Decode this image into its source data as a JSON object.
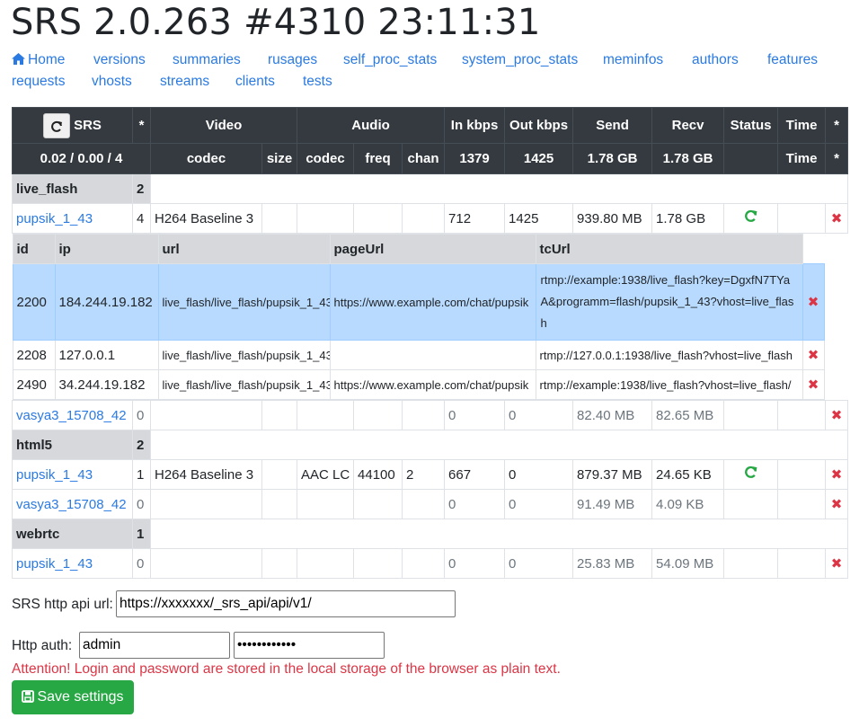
{
  "title": "SRS 2.0.263 #4310 23:11:31",
  "nav": [
    {
      "label": "Home",
      "icon": "home-icon"
    },
    {
      "label": "versions"
    },
    {
      "label": "summaries"
    },
    {
      "label": "rusages"
    },
    {
      "label": "self_proc_stats"
    },
    {
      "label": "system_proc_stats"
    },
    {
      "label": "meminfos"
    },
    {
      "label": "authors"
    },
    {
      "label": "features"
    },
    {
      "label": "requests"
    },
    {
      "label": "vhosts"
    },
    {
      "label": "streams"
    },
    {
      "label": "clients"
    },
    {
      "label": "tests"
    }
  ],
  "table": {
    "header1": {
      "srs": "SRS",
      "star": "*",
      "video": "Video",
      "audio": "Audio",
      "in_kbps": "In kbps",
      "out_kbps": "Out kbps",
      "send": "Send",
      "recv": "Recv",
      "status": "Status",
      "time": "Time",
      "star2": "*"
    },
    "header2": {
      "load": "0.02 / 0.00 / 4",
      "vcodec": "codec",
      "size": "size",
      "acodec": "codec",
      "freq": "freq",
      "chan": "chan",
      "in_kbps": "1379",
      "out_kbps": "1425",
      "send": "1.78 GB",
      "recv": "1.78 GB",
      "time": "Time",
      "star": "*"
    },
    "groups": [
      {
        "name": "live_flash",
        "count": "2",
        "streams": [
          {
            "name": "pupsik_1_43",
            "clients": "4",
            "vcodec": "H264 Baseline 3",
            "size": "",
            "acodec": "",
            "freq": "",
            "chan": "",
            "in_kbps": "712",
            "out_kbps": "1425",
            "send": "939.80 MB",
            "recv": "1.78 GB",
            "status_icon": "refresh-icon",
            "time": "",
            "client_table": {
              "headers": {
                "id": "id",
                "ip": "ip",
                "url": "url",
                "pageUrl": "pageUrl",
                "tcUrl": "tcUrl"
              },
              "rows": [
                {
                  "id": "2200",
                  "ip": "184.244.19.182",
                  "url": "live_flash/live_flash/pupsik_1_43",
                  "pageUrl": "https://www.example.com/chat/pupsik",
                  "tcUrl": "rtmp://example:1938/live_flash?key=DgxfN7TYaA&programm=flash/pupsik_1_43?vhost=live_flash",
                  "selected": true
                },
                {
                  "id": "2208",
                  "ip": "127.0.0.1",
                  "url": "live_flash/live_flash/pupsik_1_43",
                  "pageUrl": "",
                  "tcUrl": "rtmp://127.0.0.1:1938/live_flash?vhost=live_flash"
                },
                {
                  "id": "2490",
                  "ip": "34.244.19.182",
                  "url": "live_flash/live_flash/pupsik_1_43",
                  "pageUrl": "https://www.example.com/chat/pupsik",
                  "tcUrl": "rtmp://example:1938/live_flash?vhost=live_flash/"
                }
              ]
            }
          },
          {
            "name": "vasya3_15708_42",
            "clients": "0",
            "vcodec": "",
            "size": "",
            "acodec": "",
            "freq": "",
            "chan": "",
            "in_kbps": "0",
            "out_kbps": "0",
            "send": "82.40 MB",
            "recv": "82.65 MB",
            "time": ""
          }
        ]
      },
      {
        "name": "html5",
        "count": "2",
        "streams": [
          {
            "name": "pupsik_1_43",
            "clients": "1",
            "vcodec": "H264 Baseline 3",
            "size": "",
            "acodec": "AAC LC",
            "freq": "44100",
            "chan": "2",
            "in_kbps": "667",
            "out_kbps": "0",
            "send": "879.37 MB",
            "recv": "24.65 KB",
            "status_icon": "refresh-icon",
            "time": ""
          },
          {
            "name": "vasya3_15708_42",
            "clients": "0",
            "vcodec": "",
            "size": "",
            "acodec": "",
            "freq": "",
            "chan": "",
            "in_kbps": "0",
            "out_kbps": "0",
            "send": "91.49 MB",
            "recv": "4.09 KB",
            "time": ""
          }
        ]
      },
      {
        "name": "webrtc",
        "count": "1",
        "streams": [
          {
            "name": "pupsik_1_43",
            "clients": "0",
            "vcodec": "",
            "size": "",
            "acodec": "",
            "freq": "",
            "chan": "",
            "in_kbps": "0",
            "out_kbps": "0",
            "send": "25.83 MB",
            "recv": "54.09 MB",
            "time": ""
          }
        ]
      }
    ]
  },
  "form": {
    "api_label": "SRS http api url:",
    "api_value": "https://xxxxxxx/_srs_api/api/v1/",
    "auth_label": "Http auth:",
    "auth_user": "admin",
    "auth_pass": "••••••••••••",
    "warning": "Attention! Login and password are stored in the local storage of the browser as plain text.",
    "save_label": "Save settings"
  },
  "colors": {
    "link": "#2a7ae2",
    "header_bg": "#343a40",
    "group_bg": "#d6d8db",
    "selected_bg": "#b8daff",
    "danger": "#dc3545",
    "success": "#28a745"
  }
}
